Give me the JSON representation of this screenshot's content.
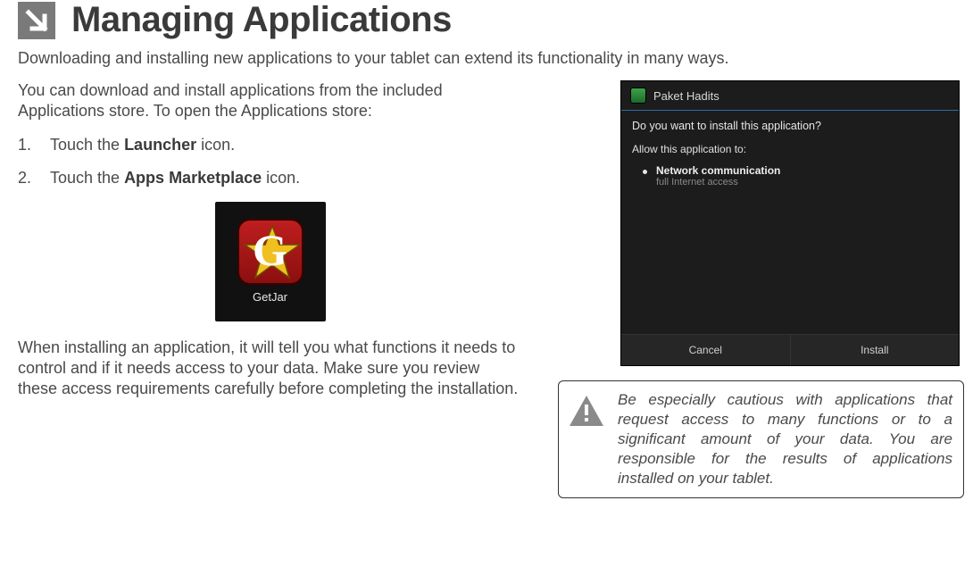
{
  "heading": "Managing Applications",
  "intro": "Downloading and installing new applications to your tablet can extend its functionality in many ways.",
  "left": {
    "open_store_para_1": "You can download and install applications from the included Applications store. To open the Applications store:",
    "steps": [
      {
        "pre": "Touch the ",
        "bold": "Launcher",
        "post": " icon."
      },
      {
        "pre": "Touch the ",
        "bold": "Apps Marketplace",
        "post": " icon."
      }
    ],
    "getjar_label": "GetJar",
    "install_para": "When installing an application, it will tell you what functions it needs to control and if it needs access to your data. Make sure you review these access requirements carefully before completing the installation."
  },
  "android": {
    "app_name": "Paket Hadits",
    "question": "Do you want to install this application?",
    "allow_heading": "Allow this application to:",
    "perm_title": "Network communication",
    "perm_detail": "full Internet access",
    "cancel": "Cancel",
    "install": "Install"
  },
  "caution": "Be especially cautious with applications that request access to many functions or to a significant amount of your data. You are responsible for the results of applications installed on your tablet."
}
